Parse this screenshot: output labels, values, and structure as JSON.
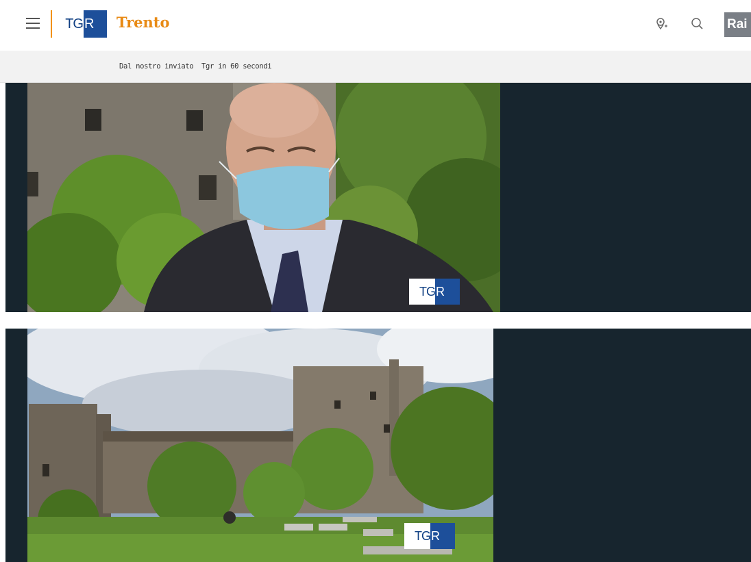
{
  "header": {
    "logo_tg": "TG",
    "logo_r": "R",
    "region": "Trento",
    "rai": "Rai",
    "icons": [
      "menu-icon",
      "location-icon",
      "search-icon"
    ]
  },
  "subnav": {
    "items": [
      {
        "label": "Dal nostro inviato"
      },
      {
        "label": "Tgr in 60 secondi"
      }
    ]
  },
  "videos": [
    {
      "watermark_tg": "TG",
      "watermark_r": "R"
    },
    {
      "watermark_tg": "TG",
      "watermark_r": "R"
    }
  ],
  "colors": {
    "accent": "#e88a14",
    "brand_blue": "#1d4f9a",
    "panel_bg": "#17252e",
    "subnav_bg": "#f2f2f2"
  }
}
